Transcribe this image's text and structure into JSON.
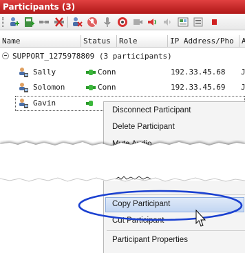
{
  "window": {
    "title": "Participants (3)"
  },
  "toolbar": {
    "buttons": [
      "add-participant-icon",
      "address-book-icon",
      "connect-icon",
      "disconnect-icon",
      "delete-participant-icon",
      "mute-audio-icon",
      "microphone-icon",
      "block-video-icon",
      "conference-video-icon",
      "speaker-volume-icon",
      "volume-down-icon",
      "layout-icon",
      "record-icon"
    ]
  },
  "table": {
    "columns": [
      "Name",
      "Status",
      "Role",
      "IP Address/Pho",
      "Al"
    ],
    "group": {
      "label": "SUPPORT_1275978809 (3 participants)"
    },
    "rows": [
      {
        "name": "Sally",
        "status": "Conn",
        "ip": "192.33.45.68",
        "extra": "J"
      },
      {
        "name": "Solomon",
        "status": "Conn",
        "ip": "192.33.45.69",
        "extra": "J"
      },
      {
        "name": "Gavin",
        "status": "",
        "ip": "",
        "extra": ""
      }
    ]
  },
  "context_menu": {
    "items_top": [
      "Disconnect Participant",
      "Delete Participant",
      "Mute Audio"
    ],
    "items_bottom": [
      "Copy Participant",
      "Cut Participant",
      "Participant Properties"
    ],
    "highlighted": "Copy Participant"
  },
  "colors": {
    "title_bar": "#c82020",
    "status_green": "#2a9a2a",
    "menu_highlight": "#c2d6f2",
    "annotation_ellipse": "#1a40d0"
  }
}
